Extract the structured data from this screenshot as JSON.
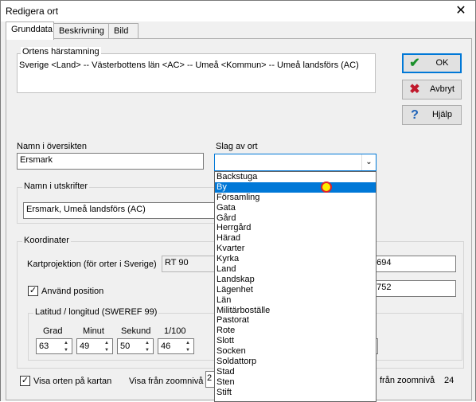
{
  "window": {
    "title": "Redigera ort",
    "close_glyph": "✕"
  },
  "tabs": [
    {
      "label": "Grunddata",
      "active": true
    },
    {
      "label": "Beskrivning",
      "active": false
    },
    {
      "label": "Bild",
      "active": false
    }
  ],
  "origin": {
    "legend": "Ortens härstamning",
    "text": "Sverige <Land> -- Västerbottens län <AC> -- Umeå <Kommun> -- Umeå landsförs (AC)"
  },
  "buttons": {
    "ok": {
      "label": "OK",
      "icon": "check-icon"
    },
    "cancel": {
      "label": "Avbryt",
      "icon": "x-icon"
    },
    "help": {
      "label": "Hjälp",
      "icon": "question-icon"
    }
  },
  "name_overview": {
    "label": "Namn i översikten",
    "value": "Ersmark"
  },
  "place_type": {
    "label": "Slag av ort",
    "value": "",
    "options": [
      "Backstuga",
      "By",
      "Församling",
      "Gata",
      "Gård",
      "Herrgård",
      "Härad",
      "Kvarter",
      "Kyrka",
      "Land",
      "Landskap",
      "Lägenhet",
      "Län",
      "Militärboställe",
      "Pastorat",
      "Rote",
      "Slott",
      "Socken",
      "Soldattorp",
      "Stad",
      "Sten",
      "Stift"
    ],
    "highlighted": "By"
  },
  "name_print": {
    "legend": "Namn i utskrifter",
    "value": "Ersmark, Umeå landsförs (AC)"
  },
  "coords": {
    "legend": "Koordinater",
    "projection_label": "Kartprojektion (för orter i Sverige)",
    "projection_value": "RT 90",
    "field1_value": "7694",
    "field2_value": "4752",
    "use_position_label": "Använd position",
    "use_position_checked": true,
    "latlon": {
      "legend": "Latitud / longitud (SWEREF 99)",
      "headers": [
        "Grad",
        "Minut",
        "Sekund",
        "1/100"
      ],
      "values": [
        "63",
        "49",
        "50",
        "46"
      ]
    }
  },
  "footer": {
    "show_on_map_label": "Visa orten på kartan",
    "show_on_map_checked": true,
    "zoom_from_label": "Visa från zoomnivå",
    "zoom_from_value": "2",
    "zoom_to_label": "från  zoomnivå",
    "zoom_to_value": "24"
  }
}
